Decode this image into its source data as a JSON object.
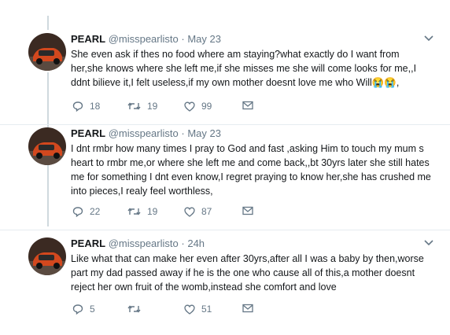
{
  "tweets": [
    {
      "name": "PEARL",
      "handle": "@misspearlisto",
      "dot": "·",
      "time": "May 23",
      "text": "She even ask if thes no food where am staying?what exactly do I want from her,she knows where she left me,if she misses me she will come looks for me,,I ddnt bilieve it,I felt useless,if my own mother doesnt love me who Will😭😭,",
      "replies": "18",
      "retweets": "19",
      "likes": "99"
    },
    {
      "name": "PEARL",
      "handle": "@misspearlisto",
      "dot": "·",
      "time": "May 23",
      "text": "I dnt rmbr how many times I pray to God  and fast ,asking Him to touch my mum s heart to rmbr me,or where she left me and come back,,bt 30yrs later she still hates me for something I dnt even know,I regret praying to know her,she has crushed me into pieces,I realy feel worthless,",
      "replies": "22",
      "retweets": "19",
      "likes": "87"
    },
    {
      "name": "PEARL",
      "handle": "@misspearlisto",
      "dot": "·",
      "time": "24h",
      "text": "Like what that can make her even after 30yrs,after all I was a baby by then,worse part my dad passed away if he is the one who cause all of this,a mother doesnt reject her own fruit of the womb,instead she comfort and love",
      "replies": "5",
      "retweets": "",
      "likes": "51"
    }
  ],
  "icons": {
    "reply": "reply-icon",
    "retweet": "retweet-icon",
    "like": "heart-icon",
    "dm": "envelope-icon",
    "caret": "chevron-down-icon"
  },
  "colors": {
    "muted": "#657786",
    "accent": "#1da1f2",
    "thread": "#cfd9de"
  }
}
